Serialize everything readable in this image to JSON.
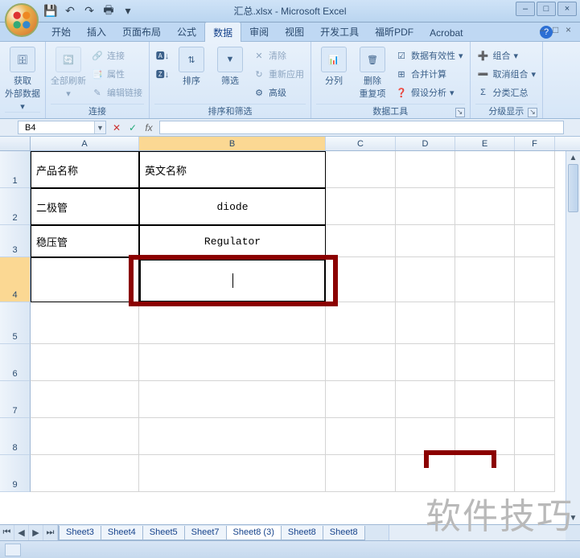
{
  "title": "汇总.xlsx - Microsoft Excel",
  "qat": {
    "save": "💾",
    "undo": "↶",
    "redo": "↷",
    "print": "🖶",
    "more": "▾"
  },
  "tabs": {
    "home": "开始",
    "insert": "插入",
    "layout": "页面布局",
    "formula": "公式",
    "data": "数据",
    "review": "审阅",
    "view": "视图",
    "dev": "开发工具",
    "foxit": "福昕PDF",
    "acrobat": "Acrobat"
  },
  "ribbon": {
    "get_data": "获取\n外部数据",
    "refresh": "全部刷新",
    "conn": "连接",
    "prop": "属性",
    "edit_link": "编辑链接",
    "conn_group": "连接",
    "sort_asc": "A↓Z",
    "sort_desc": "Z↓A",
    "sort": "排序",
    "filter": "筛选",
    "clear": "清除",
    "reapply": "重新应用",
    "advanced": "高级",
    "sort_group": "排序和筛选",
    "text_col": "分列",
    "remove_dup": "删除\n重复项",
    "validation": "数据有效性",
    "consolidate": "合并计算",
    "whatif": "假设分析",
    "data_tools": "数据工具",
    "group": "组合",
    "ungroup": "取消组合",
    "subtotal": "分类汇总",
    "outline": "分级显示"
  },
  "name_box": "B4",
  "fx": {
    "cancel": "✕",
    "enter": "✓",
    "fx": "fx"
  },
  "columns": {
    "A": "A",
    "B": "B",
    "C": "C",
    "D": "D",
    "E": "E",
    "F": "F"
  },
  "col_widths": {
    "A": 135,
    "B": 232,
    "C": 87,
    "D": 74,
    "E": 74,
    "F": 50
  },
  "rows": [
    "1",
    "2",
    "3",
    "4",
    "5",
    "6",
    "7",
    "8",
    "9"
  ],
  "cells": {
    "A1": "产品名称",
    "B1": "英文名称",
    "A2": "二极管",
    "B2": "diode",
    "A3": "稳压管",
    "B3": "Regulator"
  },
  "sheets": [
    "Sheet3",
    "Sheet4",
    "Sheet5",
    "Sheet7",
    "Sheet8 (3)",
    "Sheet8",
    "Sheet8"
  ],
  "active_sheet": 4,
  "watermark": "软件技巧"
}
